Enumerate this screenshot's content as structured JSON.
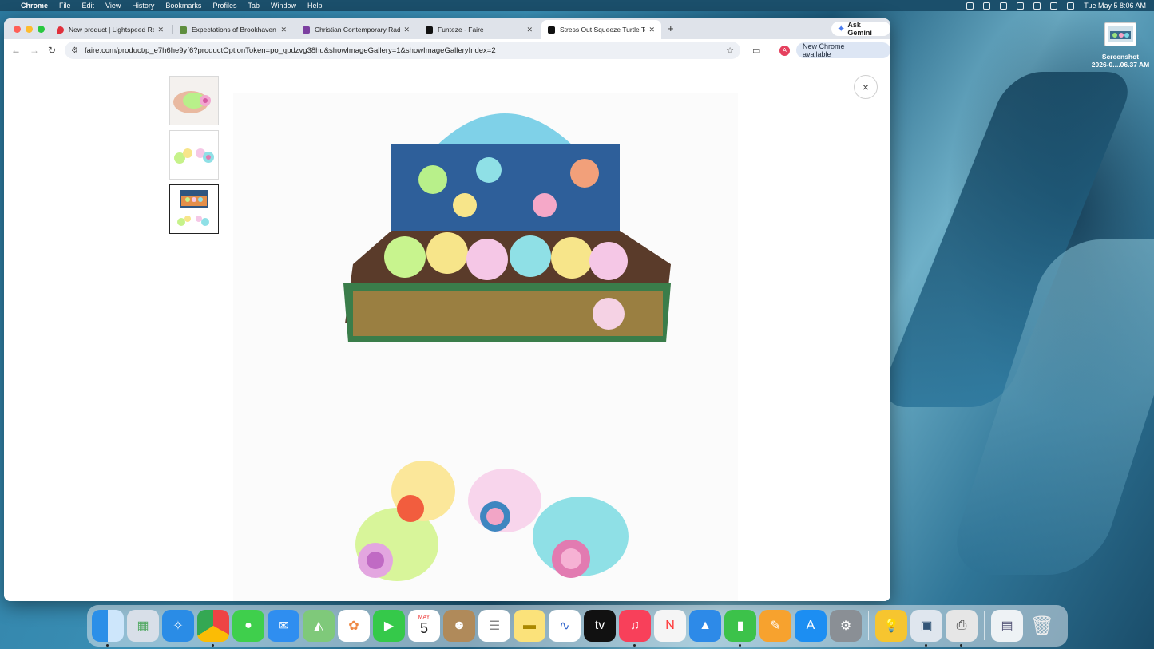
{
  "menubar": {
    "app": "Chrome",
    "items": [
      "File",
      "Edit",
      "View",
      "History",
      "Bookmarks",
      "Profiles",
      "Tab",
      "Window",
      "Help"
    ],
    "datetime": "Tue May 5  8:06 AM"
  },
  "browser": {
    "tabs": [
      {
        "title": "New product | Lightspeed Re",
        "favicon_color": "#e0303c"
      },
      {
        "title": "Expectations of Brookhaven",
        "favicon_color": "#5e8e3e"
      },
      {
        "title": "Christian Contemporary Radi",
        "favicon_color": "#7b3fa0"
      },
      {
        "title": "Funteze - Faire",
        "favicon_color": "#111111"
      },
      {
        "title": "Stress Out Squeeze Turtle To",
        "favicon_color": "#111111"
      }
    ],
    "active_tab_index": 4,
    "new_tab_symbol": "+",
    "gemini_label": "Ask Gemini",
    "url": "faire.com/product/p_e7h6he9yf6?productOptionToken=po_qpdzvg38hu&showImageGallery=1&showImageGalleryIndex=2",
    "profile_initial": "A",
    "update_label": "New Chrome available"
  },
  "gallery": {
    "thumbnail_count": 3,
    "selected_index": 2,
    "close_symbol": "×"
  },
  "desktop": {
    "screenshot_label_line1": "Screenshot",
    "screenshot_label_line2": "2026-0....06.37 AM"
  },
  "dock": {
    "calendar_month": "MAY",
    "calendar_day": "5"
  }
}
